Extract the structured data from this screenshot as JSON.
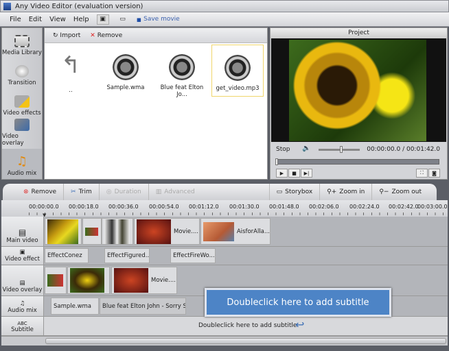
{
  "window": {
    "title": "Any Video Editor (evaluation version)"
  },
  "menu": [
    "File",
    "Edit",
    "View",
    "Help"
  ],
  "toolbar": {
    "save_label": "Save movie"
  },
  "sidebar": {
    "items": [
      {
        "label": "Media Library"
      },
      {
        "label": "Transition"
      },
      {
        "label": "Video effects"
      },
      {
        "label": "Video overlay"
      },
      {
        "label": "Audio mix",
        "active": true
      }
    ]
  },
  "media": {
    "import_label": "Import",
    "remove_label": "Remove",
    "files": [
      {
        "name": ".."
      },
      {
        "name": "Sample.wma"
      },
      {
        "name": "Blue feat Elton Jo..."
      },
      {
        "name": "get_video.mp3",
        "selected": true
      }
    ]
  },
  "project": {
    "title": "Project",
    "status": "Stop",
    "time": "00:00:00.0 / 00:01:42.0",
    "volume": 0.55,
    "progress": 0
  },
  "timeline": {
    "toolbar": {
      "remove": "Remove",
      "trim": "Trim",
      "duration": "Duration",
      "advanced": "Advanced",
      "storybox": "Storybox",
      "zoom_in": "Zoom in",
      "zoom_out": "Zoom out"
    },
    "ticks": [
      "00:00:00.0",
      "00:00:18.0",
      "00:00:36.0",
      "00:00:54.0",
      "00:01:12.0",
      "00:01:30.0",
      "00:01:48.0",
      "00:02:06.0",
      "00:02:24.0",
      "00:02:42.0",
      "00:03:00.0"
    ],
    "tracks": {
      "main_video": "Main video",
      "video_effect": "Video effect",
      "video_overlay": "Video overlay",
      "audio_mix": "Audio mix",
      "subtitle": "Subtitle",
      "subtitle_icon": "ABC"
    },
    "main_clips": [
      "Movie....",
      "AisforAlla..."
    ],
    "effect_clips": [
      "EffectConez",
      "EffectFigured...",
      "EffectFireWo..."
    ],
    "overlay_clips": [
      "Movie...."
    ],
    "audio_clips": [
      "Sample.wma",
      "Blue feat Elton John - Sorry S..."
    ],
    "subtitle_hint": "Doubleclick here to add subtitle",
    "tooltip": "Doubleclick here to add subtitle"
  },
  "colors": {
    "accent": "#4d84c6"
  }
}
